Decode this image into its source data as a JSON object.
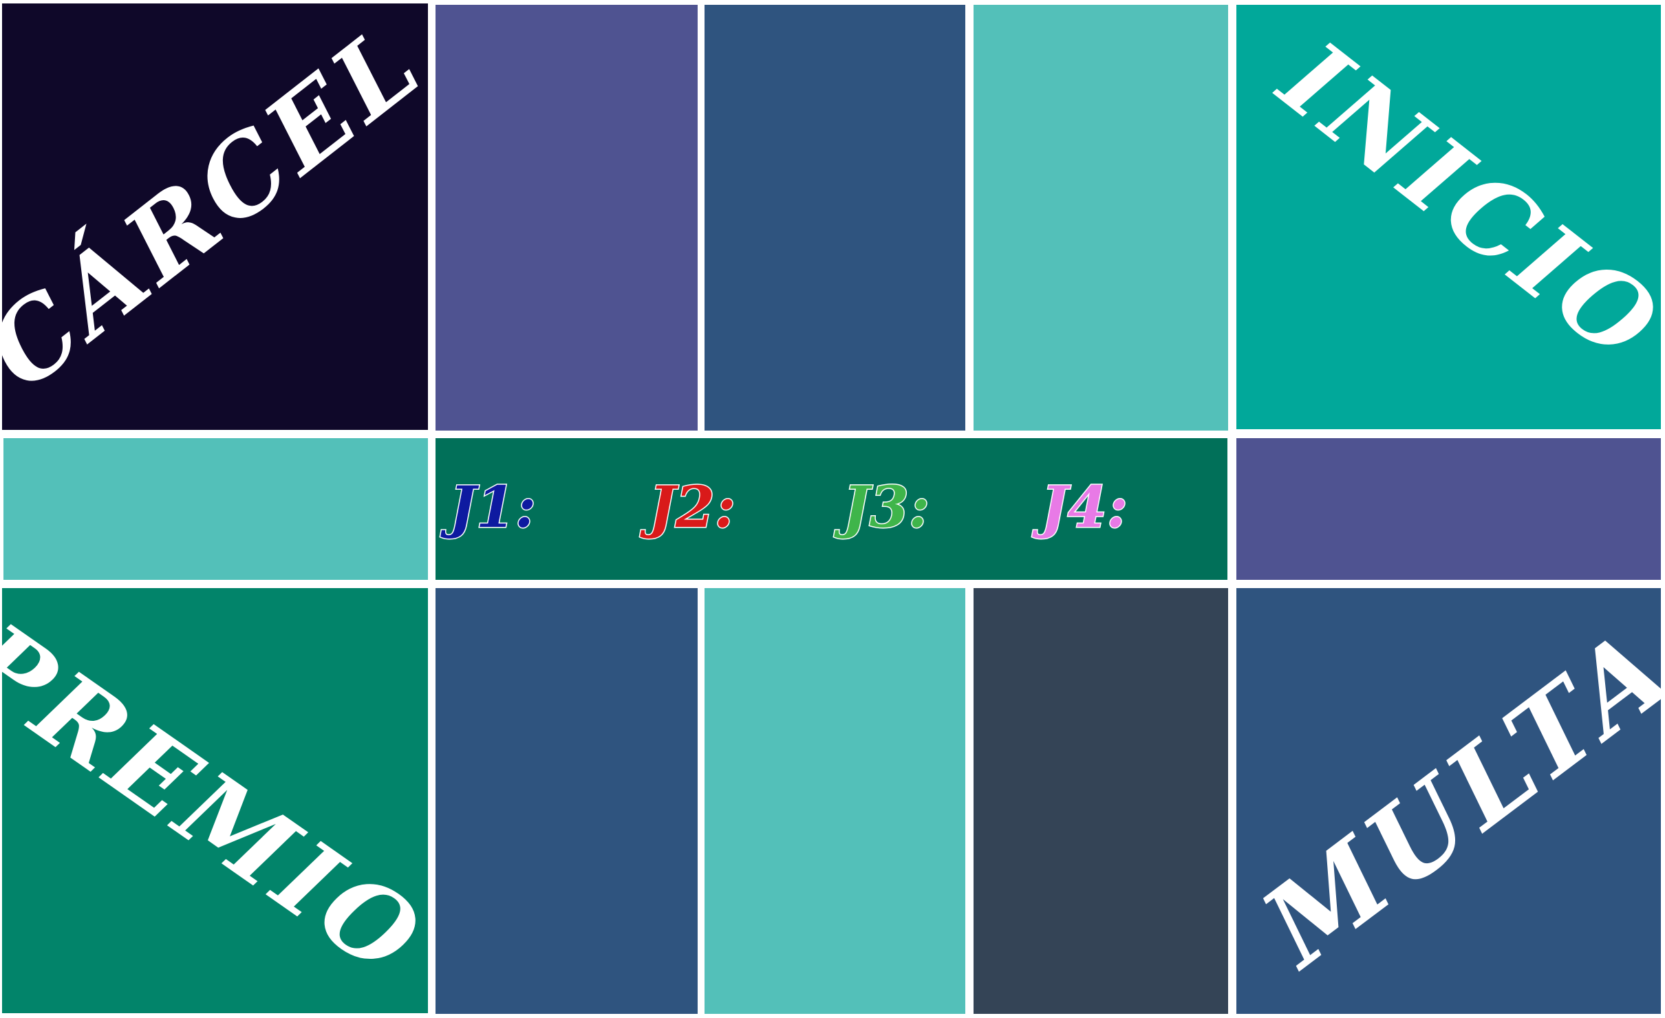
{
  "board": {
    "corners": {
      "carcel": {
        "label": "CÁRCEL",
        "color": "#0f0829"
      },
      "inicio": {
        "label": "INICIO",
        "color": "#01a89a"
      },
      "premio": {
        "label": "PREMIO",
        "color": "#02846a"
      },
      "multa": {
        "label": "MULTA",
        "color": "#2f547f"
      }
    },
    "top_squares": [
      {
        "color": "#4f5391"
      },
      {
        "color": "#2f547f"
      },
      {
        "color": "#53c0b9"
      }
    ],
    "middle": {
      "left_color": "#53c0b9",
      "center_color": "#017059",
      "right_color": "#4f5391"
    },
    "bottom_squares": [
      {
        "color": "#2f547f"
      },
      {
        "color": "#53c0b9"
      },
      {
        "color": "#344456"
      }
    ],
    "players": [
      {
        "label": "J1:",
        "color": "#0e1aa0"
      },
      {
        "label": "J2:",
        "color": "#d91a1a"
      },
      {
        "label": "J3:",
        "color": "#3fb54a"
      },
      {
        "label": "J4:",
        "color": "#e87ae6"
      }
    ]
  }
}
